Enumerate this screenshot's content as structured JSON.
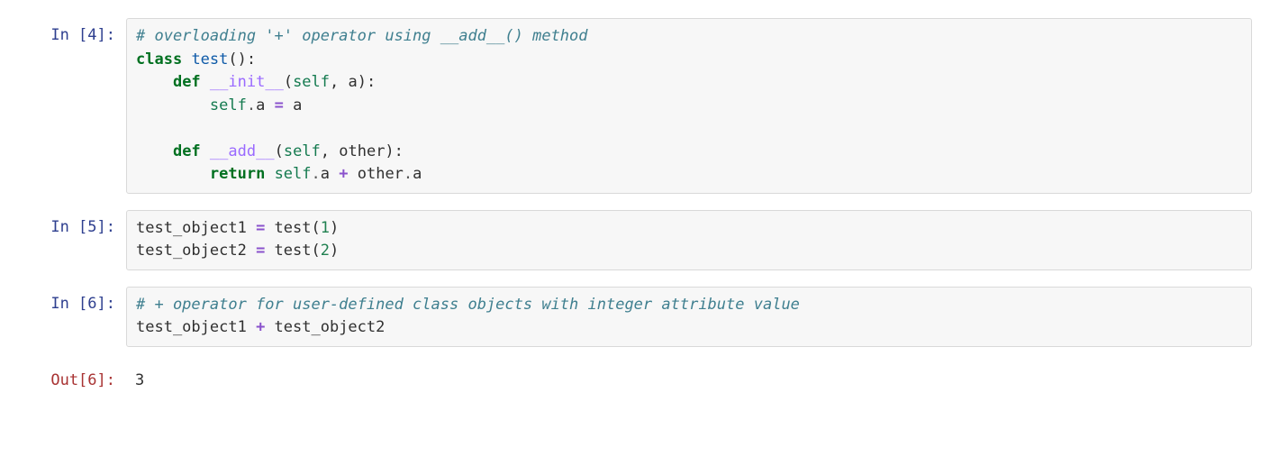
{
  "cells": [
    {
      "kind": "code",
      "prompt": "In [4]:",
      "tokens": [
        {
          "cls": "tok-comment",
          "txt": "# overloading '+' operator using __add__() method"
        },
        {
          "txt": "\n"
        },
        {
          "cls": "tok-keyword",
          "txt": "class"
        },
        {
          "txt": " "
        },
        {
          "cls": "tok-class",
          "txt": "test"
        },
        {
          "txt": "():\n    "
        },
        {
          "cls": "tok-keyword",
          "txt": "def"
        },
        {
          "txt": " "
        },
        {
          "cls": "tok-dunder",
          "txt": "__init__"
        },
        {
          "txt": "("
        },
        {
          "cls": "tok-self",
          "txt": "self"
        },
        {
          "txt": ", a):\n        "
        },
        {
          "cls": "tok-self",
          "txt": "self"
        },
        {
          "cls": "tok-op",
          "txt": "."
        },
        {
          "txt": "a "
        },
        {
          "cls": "tok-opbold",
          "txt": "="
        },
        {
          "txt": " a\n\n    "
        },
        {
          "cls": "tok-keyword",
          "txt": "def"
        },
        {
          "txt": " "
        },
        {
          "cls": "tok-dunder",
          "txt": "__add__"
        },
        {
          "txt": "("
        },
        {
          "cls": "tok-self",
          "txt": "self"
        },
        {
          "txt": ", other):\n        "
        },
        {
          "cls": "tok-keyword",
          "txt": "return"
        },
        {
          "txt": " "
        },
        {
          "cls": "tok-self",
          "txt": "self"
        },
        {
          "cls": "tok-op",
          "txt": "."
        },
        {
          "txt": "a "
        },
        {
          "cls": "tok-opbold",
          "txt": "+"
        },
        {
          "txt": " other"
        },
        {
          "cls": "tok-op",
          "txt": "."
        },
        {
          "txt": "a"
        }
      ]
    },
    {
      "kind": "code",
      "prompt": "In [5]:",
      "tokens": [
        {
          "txt": "test_object1 "
        },
        {
          "cls": "tok-opbold",
          "txt": "="
        },
        {
          "txt": " test("
        },
        {
          "cls": "tok-num",
          "txt": "1"
        },
        {
          "txt": ")\ntest_object2 "
        },
        {
          "cls": "tok-opbold",
          "txt": "="
        },
        {
          "txt": " test("
        },
        {
          "cls": "tok-num",
          "txt": "2"
        },
        {
          "txt": ")"
        }
      ]
    },
    {
      "kind": "code",
      "prompt": "In [6]:",
      "tokens": [
        {
          "cls": "tok-comment",
          "txt": "# + operator for user-defined class objects with integer attribute value"
        },
        {
          "txt": "\ntest_object1 "
        },
        {
          "cls": "tok-opbold",
          "txt": "+"
        },
        {
          "txt": " test_object2"
        }
      ]
    },
    {
      "kind": "output",
      "prompt": "Out[6]:",
      "tokens": [
        {
          "txt": "3"
        }
      ]
    }
  ]
}
